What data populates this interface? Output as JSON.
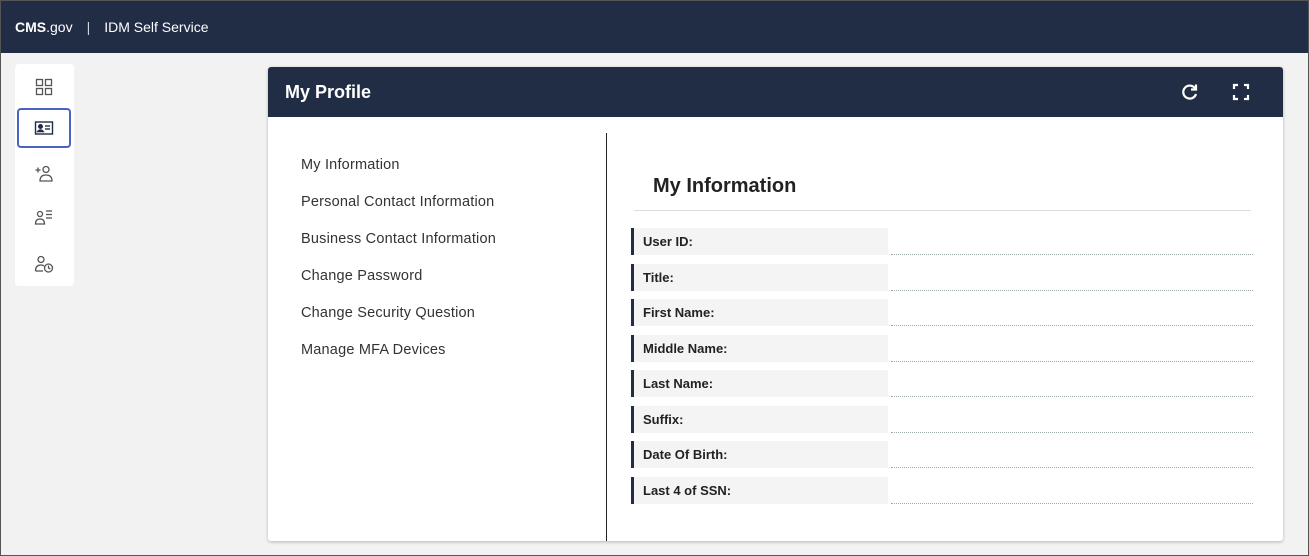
{
  "topbar": {
    "brand_bold": "CMS",
    "brand_rest": ".gov",
    "separator": "|",
    "app_title": "IDM Self Service"
  },
  "sidenav": [
    {
      "icon": "dashboard-grid-icon",
      "active": false
    },
    {
      "icon": "profile-card-icon",
      "active": true
    },
    {
      "icon": "add-user-icon",
      "active": false
    },
    {
      "icon": "user-list-icon",
      "active": false
    },
    {
      "icon": "user-history-icon",
      "active": false
    }
  ],
  "card": {
    "title": "My Profile",
    "header_icons": [
      "refresh-icon",
      "fullscreen-icon"
    ]
  },
  "menu": [
    "My Information",
    "Personal Contact Information",
    "Business Contact Information",
    "Change Password",
    "Change Security Question",
    "Manage MFA Devices"
  ],
  "section": {
    "title": "My Information",
    "fields": [
      {
        "label": "User ID:",
        "value": ""
      },
      {
        "label": "Title:",
        "value": ""
      },
      {
        "label": "First Name:",
        "value": ""
      },
      {
        "label": "Middle Name:",
        "value": ""
      },
      {
        "label": "Last Name:",
        "value": ""
      },
      {
        "label": "Suffix:",
        "value": ""
      },
      {
        "label": "Date Of Birth:",
        "value": ""
      },
      {
        "label": "Last 4 of SSN:",
        "value": ""
      }
    ]
  },
  "colors": {
    "navy": "#212d45",
    "active_border": "#4a62c5",
    "background": "#f2f2f2"
  }
}
